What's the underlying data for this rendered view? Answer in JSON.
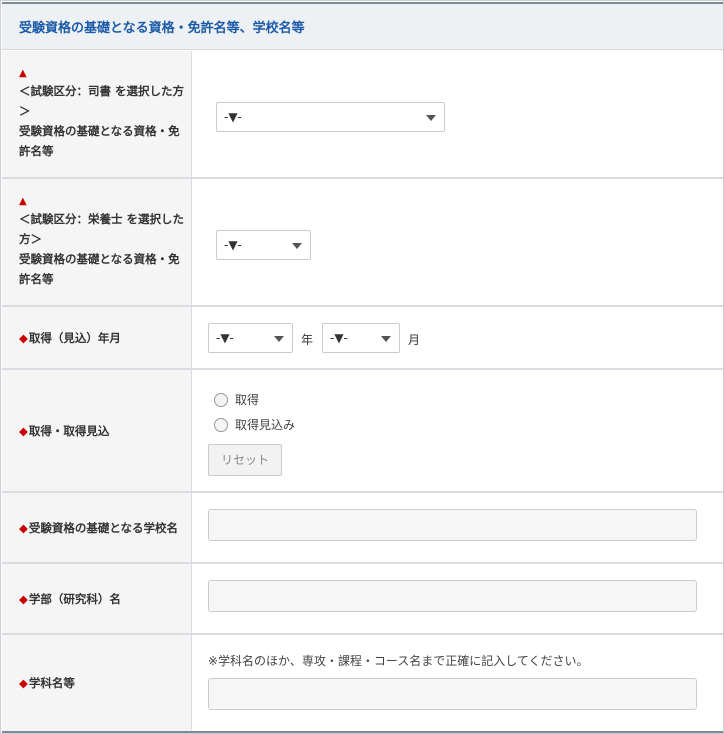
{
  "section": {
    "title": "受験資格の基礎となる資格・免許名等、学校名等"
  },
  "colors": {
    "header_text": "#1b5aa8",
    "required_mark": "#cc0000",
    "label_bg": "#f5f5f5"
  },
  "icons": {
    "required_triangle": "triangle-up-icon",
    "required_diamond": "diamond-icon",
    "dropdown": "chevron-down-icon"
  },
  "rows": {
    "librarian": {
      "mark": "▲",
      "label_line1": "＜試験区分：司書 を選択した方＞",
      "label_line2": "受験資格の基礎となる資格・免許名等",
      "select_value": "-▼-"
    },
    "dietitian": {
      "mark": "▲",
      "label_line1": "＜試験区分：栄養士 を選択した方＞",
      "label_line2": "受験資格の基礎となる資格・免許名等",
      "select_value": "-▼-"
    },
    "acquired_date": {
      "mark": "◆",
      "label": "取得（見込）年月",
      "year_value": "-▼-",
      "year_unit": "年",
      "month_value": "-▼-",
      "month_unit": "月"
    },
    "acquired_status": {
      "mark": "◆",
      "label": "取得・取得見込",
      "options": [
        "取得",
        "取得見込み"
      ],
      "reset_label": "リセット"
    },
    "school_name": {
      "mark": "◆",
      "label": "受験資格の基礎となる学校名",
      "value": ""
    },
    "faculty": {
      "mark": "◆",
      "label": "学部（研究科）名",
      "value": ""
    },
    "department": {
      "mark": "◆",
      "label": "学科名等",
      "note": "※学科名のほか、専攻・課程・コース名まで正確に記入してください。",
      "value": ""
    }
  }
}
